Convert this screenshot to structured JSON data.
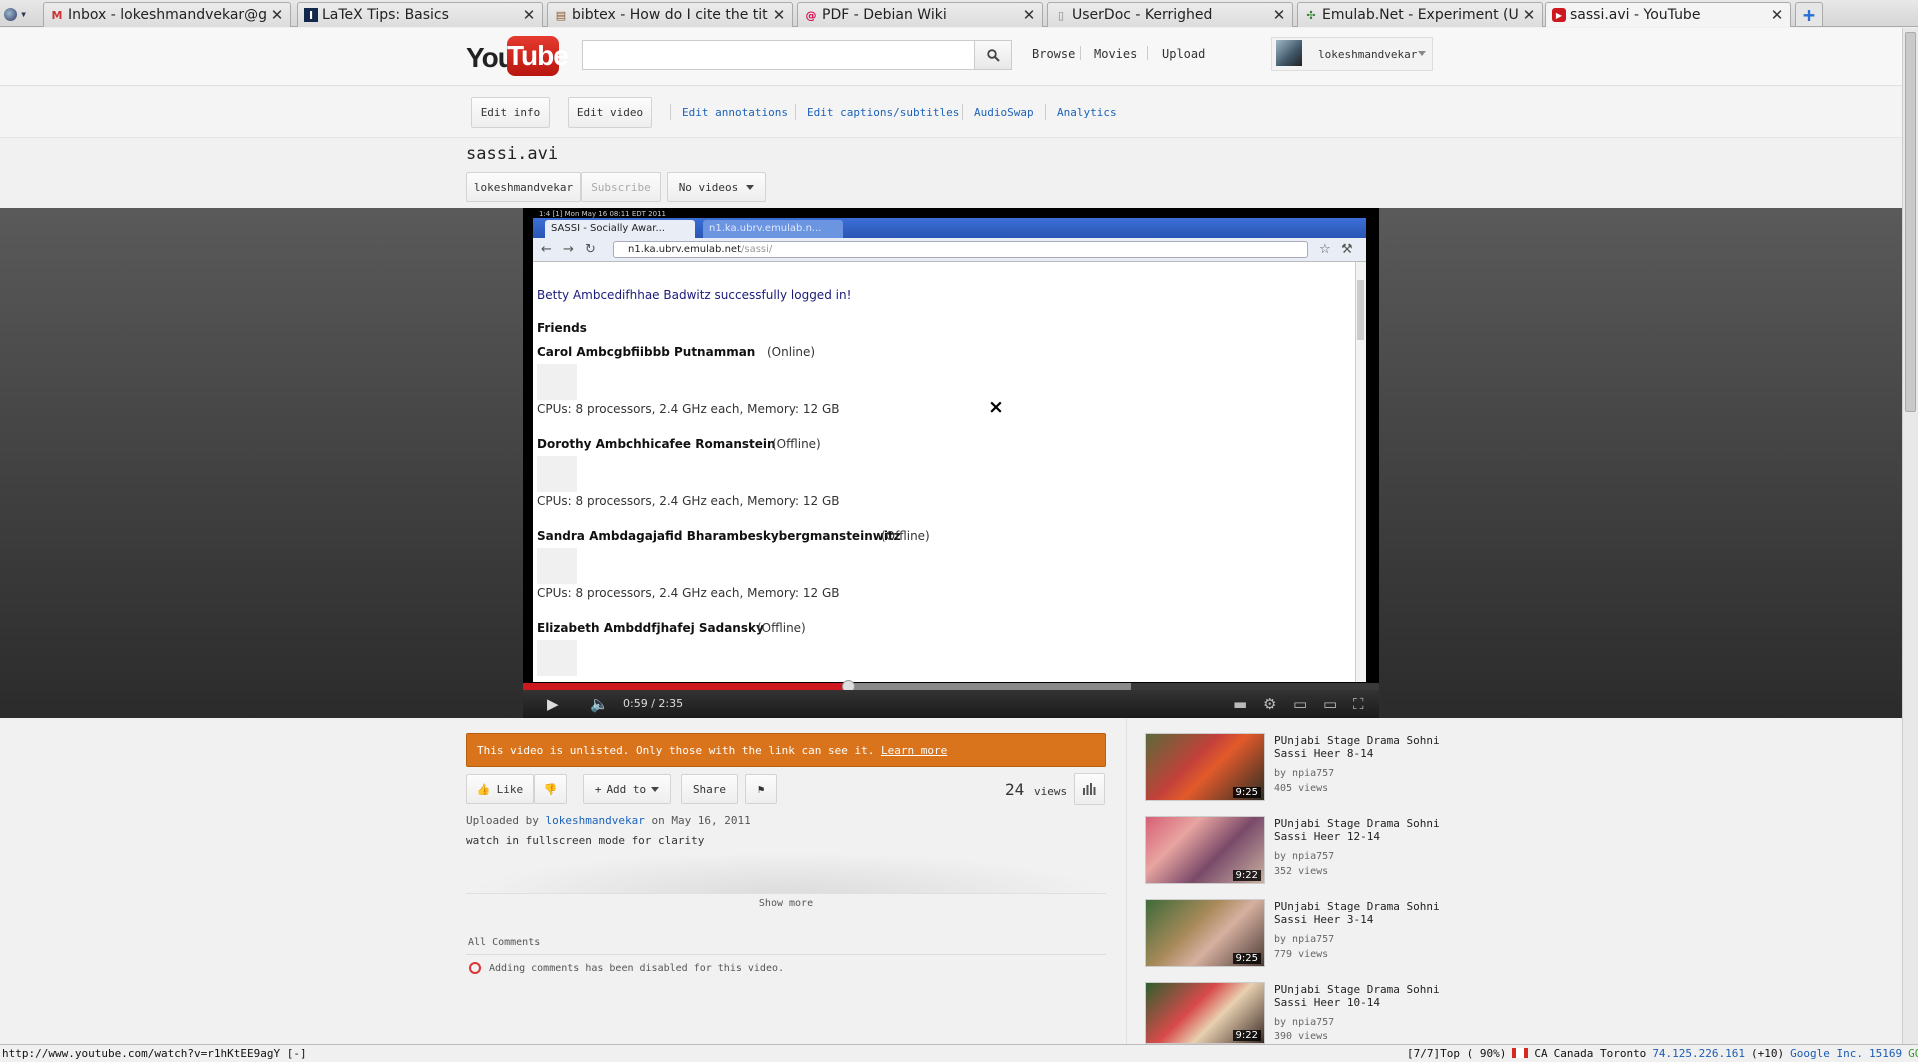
{
  "browser": {
    "tabs": [
      {
        "title": "Inbox - lokeshmandvekar@g...",
        "favicon": "gmail-icon"
      },
      {
        "title": "LaTeX Tips: Basics",
        "favicon": "uiuc-icon"
      },
      {
        "title": "bibtex - How do I cite the title ...",
        "favicon": "tex-stackexchange-icon"
      },
      {
        "title": "PDF - Debian Wiki",
        "favicon": "debian-icon"
      },
      {
        "title": "UserDoc - Kerrighed",
        "favicon": "page-icon"
      },
      {
        "title": "Emulab.Net - Experiment (UB...",
        "favicon": "emulab-icon"
      },
      {
        "title": "sassi.avi - YouTube",
        "favicon": "youtube-icon"
      }
    ],
    "active_tab_index": 6
  },
  "header": {
    "logo_you": "You",
    "logo_tube": "Tube",
    "search_placeholder": "",
    "nav": [
      "Browse",
      "Movies",
      "Upload"
    ],
    "username": "lokeshmandvekar"
  },
  "edit_bar": {
    "edit_info": "Edit info",
    "edit_video": "Edit video",
    "links": [
      "Edit annotations",
      "Edit captions/subtitles",
      "AudioSwap",
      "Analytics"
    ]
  },
  "video": {
    "title": "sassi.avi",
    "owner": "lokeshmandvekar",
    "subscribe": "Subscribe",
    "no_videos": "No videos",
    "time_current": "0:59",
    "time_total": "2:35",
    "time_display": "0:59 / 2:35",
    "progress_fraction": 0.38,
    "buffered_fraction": 0.71
  },
  "recorded_screen": {
    "sys_bar": "1:4 [1]   Mon May 16 08:11 EDT 2011",
    "tab_active": "SASSI - Socially Awar...",
    "tab_other": "n1.ka.ubrv.emulab.n...",
    "url_host": "n1.ka.ubrv.emulab.net",
    "url_path": "/sassi/",
    "login_msg": "Betty Ambcedifhhae Badwitz successfully logged in!",
    "friends_heading": "Friends",
    "friends": [
      {
        "name": "Carol Ambcgbfiibbb Putnamman",
        "status": "(Online)",
        "spec": "CPUs: 8 processors, 2.4 GHz each, Memory: 12 GB"
      },
      {
        "name": "Dorothy Ambchhicafee Romanstein",
        "status": "(Offline)",
        "spec": "CPUs: 8 processors, 2.4 GHz each, Memory: 12 GB"
      },
      {
        "name": "Sandra Ambdagajafid Bharambeskybergmansteinwitz",
        "status": "(Offline)",
        "spec": "CPUs: 8 processors, 2.4 GHz each, Memory: 12 GB"
      },
      {
        "name": "Elizabeth Ambddfjhafej Sadansky",
        "status": "(Offline)",
        "spec": ""
      }
    ],
    "close_glyph": "×"
  },
  "info": {
    "unlisted_text": "This video is unlisted. Only those with the link can see it.",
    "learn_more": "Learn more",
    "like": "Like",
    "add_to": "Add to",
    "share": "Share",
    "views_count": "24",
    "views_label": "views",
    "uploaded_prefix": "Uploaded by",
    "uploaded_user": "lokeshmandvekar",
    "uploaded_suffix": "on May 16, 2011",
    "description": "watch in fullscreen mode for clarity",
    "show_more": "Show more",
    "all_comments": "All Comments",
    "comments_disabled": "Adding comments has been disabled for this video."
  },
  "related": [
    {
      "title": "PUnjabi Stage Drama Sohni Sassi Heer 8-14",
      "by": "by npia757",
      "views": "405 views",
      "duration": "9:25"
    },
    {
      "title": "PUnjabi Stage Drama Sohni Sassi Heer 12-14",
      "by": "by npia757",
      "views": "352 views",
      "duration": "9:22"
    },
    {
      "title": "PUnjabi Stage Drama Sohni Sassi Heer 3-14",
      "by": "by npia757",
      "views": "779 views",
      "duration": "9:25"
    },
    {
      "title": "PUnjabi Stage Drama Sohni Sassi Heer 10-14",
      "by": "by npia757",
      "views": "390 views",
      "duration": "9:22"
    }
  ],
  "statusbar": {
    "url": "http://www.youtube.com/watch?v=r1hKtEE9agY [-]",
    "position": "[7/7]Top ( 90%)",
    "country": "CA",
    "location": "Canada Toronto",
    "ip": "74.125.226.161",
    "tz": "(+10)",
    "isp": "Google Inc.",
    "asn": "15169",
    "tag": "GOOGLE"
  },
  "colors": {
    "accent_link": "#1c62b9",
    "youtube_red": "#cc181e",
    "unlisted_orange": "#d9731c"
  }
}
